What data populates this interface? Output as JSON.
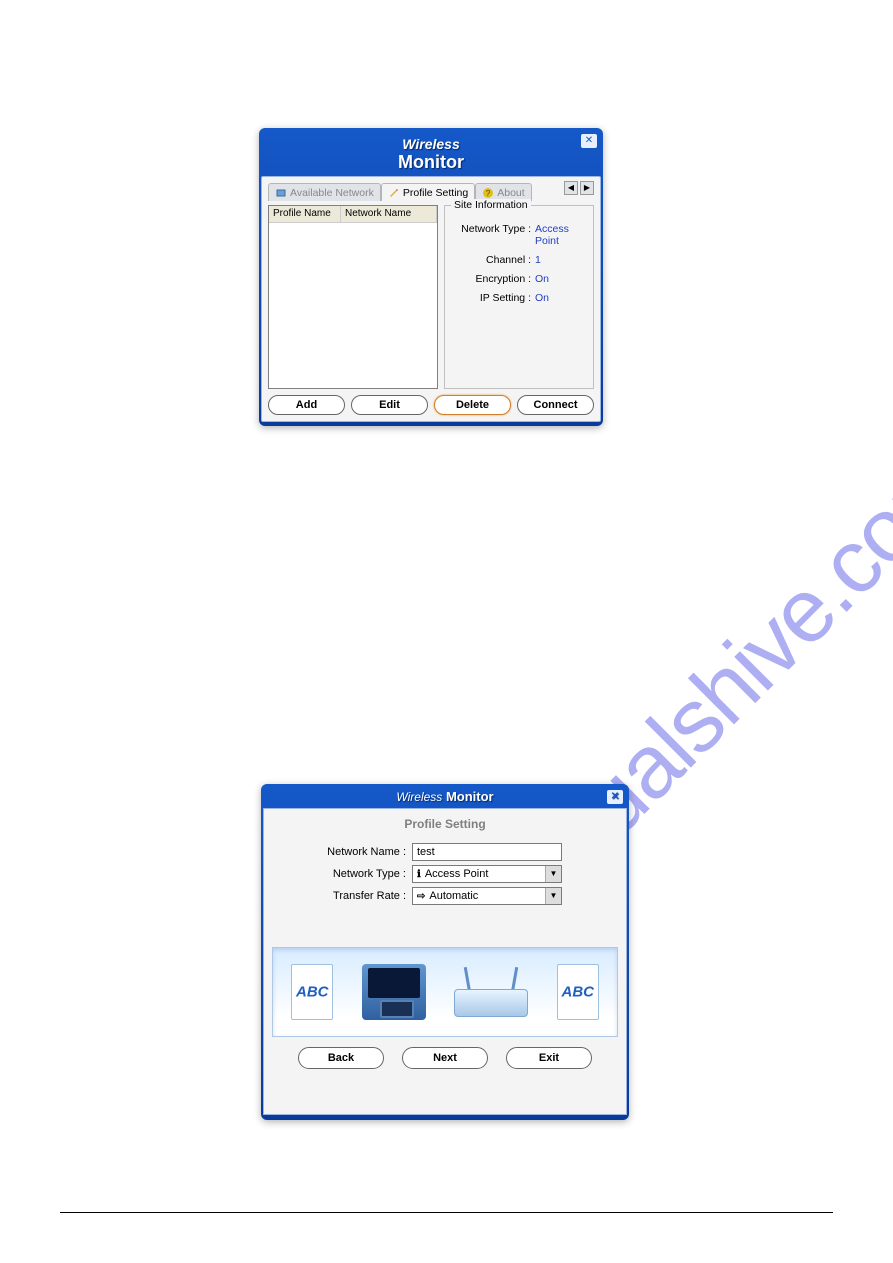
{
  "watermark": "manualshive.com",
  "window1": {
    "title_small": "Wireless",
    "title_big": "Monitor",
    "close_glyph": "✕",
    "tabs": {
      "available": "Available Network",
      "profile": "Profile Setting",
      "about": "About",
      "nav_left": "◀",
      "nav_right": "▶"
    },
    "list": {
      "col1": "Profile Name",
      "col2": "Network Name"
    },
    "group": {
      "legend": "Site Information",
      "rows": {
        "network_type_label": "Network Type :",
        "network_type_value": "Access Point",
        "channel_label": "Channel :",
        "channel_value": "1",
        "encryption_label": "Encryption :",
        "encryption_value": "On",
        "ip_label": "IP Setting :",
        "ip_value": "On"
      }
    },
    "buttons": {
      "add": "Add",
      "edit": "Edit",
      "delete": "Delete",
      "connect": "Connect"
    }
  },
  "window2": {
    "title_small": "Wireless",
    "title_big": "Monitor",
    "close_glyph": "✕",
    "subtitle": "Profile Setting",
    "form": {
      "network_name_label": "Network Name :",
      "network_name_value": "test",
      "network_type_label": "Network Type :",
      "network_type_value": "Access Point",
      "network_type_icon": "ℹ",
      "transfer_rate_label": "Transfer Rate :",
      "transfer_rate_value": "Automatic",
      "transfer_rate_icon": "⇨",
      "drop_glyph": "▼"
    },
    "buttons": {
      "back": "Back",
      "next": "Next",
      "exit": "Exit"
    }
  }
}
